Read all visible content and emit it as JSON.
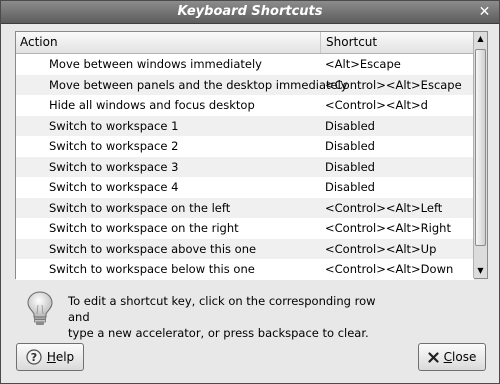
{
  "window": {
    "title": "Keyboard Shortcuts",
    "close_glyph": "✕"
  },
  "table": {
    "headers": {
      "action": "Action",
      "shortcut": "Shortcut"
    },
    "rows": [
      {
        "action": "Move between windows immediately",
        "shortcut": "<Alt>Escape"
      },
      {
        "action": "Move between panels and the desktop immediately",
        "shortcut": "<Control><Alt>Escape"
      },
      {
        "action": "Hide all windows and focus desktop",
        "shortcut": "<Control><Alt>d"
      },
      {
        "action": "Switch to workspace 1",
        "shortcut": "Disabled"
      },
      {
        "action": "Switch to workspace 2",
        "shortcut": "Disabled"
      },
      {
        "action": "Switch to workspace 3",
        "shortcut": "Disabled"
      },
      {
        "action": "Switch to workspace 4",
        "shortcut": "Disabled"
      },
      {
        "action": "Switch to workspace on the left",
        "shortcut": "<Control><Alt>Left"
      },
      {
        "action": "Switch to workspace on the right",
        "shortcut": "<Control><Alt>Right"
      },
      {
        "action": "Switch to workspace above this one",
        "shortcut": "<Control><Alt>Up"
      },
      {
        "action": "Switch to workspace below this one",
        "shortcut": "<Control><Alt>Down"
      }
    ]
  },
  "hint": {
    "icon": "lightbulb-icon",
    "line1": "To edit a shortcut key, click on the corresponding row and",
    "line2": "type a new accelerator, or press backspace to clear."
  },
  "buttons": {
    "help": {
      "label_mnemonic": "H",
      "label_rest": "elp",
      "icon": "help-icon"
    },
    "close": {
      "label_mnemonic": "C",
      "label_rest": "lose",
      "icon": "close-icon"
    }
  }
}
